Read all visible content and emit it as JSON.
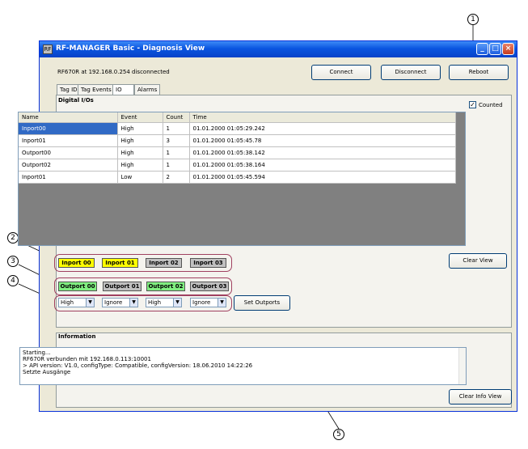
{
  "window": {
    "title": "RF-MANAGER Basic - Diagnosis View",
    "app_icon": "RF",
    "controls": {
      "minimize": "_",
      "maximize": "□",
      "close": "×"
    }
  },
  "status_text": "RF670R at 192.168.0.254 disconnected",
  "toolbar": {
    "connect": "Connect",
    "disconnect": "Disconnect",
    "reboot": "Reboot"
  },
  "tabs": [
    {
      "label": "Tag ID"
    },
    {
      "label": "Tag Events"
    },
    {
      "label": "IO"
    },
    {
      "label": "Alarms"
    }
  ],
  "digital_io": {
    "title": "Digital I/Os",
    "counted_label": "Counted",
    "counted_checked": "✓",
    "columns": [
      "Name",
      "Event",
      "Count",
      "Time"
    ],
    "rows": [
      {
        "name": "Inport00",
        "event": "High",
        "count": "1",
        "time": "01.01.2000 01:05:29.242"
      },
      {
        "name": "Inport01",
        "event": "High",
        "count": "3",
        "time": "01.01.2000 01:05:45.78"
      },
      {
        "name": "Outport00",
        "event": "High",
        "count": "1",
        "time": "01.01.2000 01:05:38.142"
      },
      {
        "name": "Outport02",
        "event": "High",
        "count": "1",
        "time": "01.01.2000 01:05:38.164"
      },
      {
        "name": "Inport01",
        "event": "Low",
        "count": "2",
        "time": "01.01.2000 01:05:45.594"
      }
    ],
    "clear_view": "Clear View",
    "inports": [
      "Inport 00",
      "Inport 01",
      "Inport 02",
      "Inport 03"
    ],
    "outports": [
      "Outport 00",
      "Outport 01",
      "Outport 02",
      "Outport 03"
    ],
    "outport_selects": [
      "High",
      "Ignore",
      "High",
      "Ignore"
    ],
    "set_outports": "Set Outports"
  },
  "information": {
    "title": "Information",
    "log": [
      "Starting...",
      "RF670R verbunden mit 192.168.0.113:10001",
      "> API version: V1.0, configType: Compatible, configVersion: 18.06.2010 14:22:26",
      "Setzte Ausgänge"
    ],
    "clear_info_view": "Clear Info View"
  },
  "callouts": [
    "1",
    "2",
    "3",
    "4",
    "5"
  ],
  "colors": {
    "input_active": "#ffff00",
    "output_active": "#80ee80",
    "inactive": "#c0c0c0",
    "selected_row": "#316ac5"
  }
}
